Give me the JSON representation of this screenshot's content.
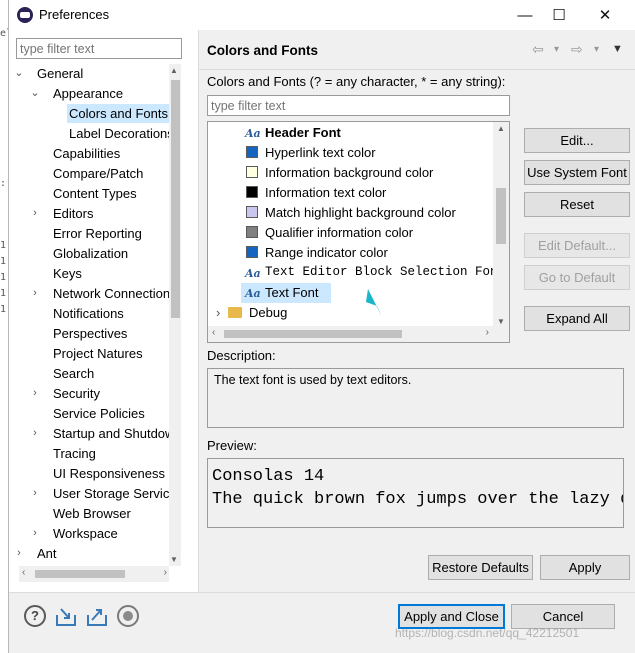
{
  "window": {
    "title": "Preferences"
  },
  "controls": {
    "minimize": "—",
    "maximize": "☐",
    "close": "✕"
  },
  "left": {
    "filter_placeholder": "type filter text",
    "tree": [
      {
        "label": "General",
        "arrow": "⌄",
        "level": 0
      },
      {
        "label": "Appearance",
        "arrow": "⌄",
        "level": 1
      },
      {
        "label": "Colors and Fonts",
        "arrow": "",
        "level": 2,
        "selected": true
      },
      {
        "label": "Label Decorations",
        "arrow": "",
        "level": 2
      },
      {
        "label": "Capabilities",
        "arrow": "",
        "level": 1
      },
      {
        "label": "Compare/Patch",
        "arrow": "",
        "level": 1
      },
      {
        "label": "Content Types",
        "arrow": "",
        "level": 1
      },
      {
        "label": "Editors",
        "arrow": "›",
        "level": 1
      },
      {
        "label": "Error Reporting",
        "arrow": "",
        "level": 1
      },
      {
        "label": "Globalization",
        "arrow": "",
        "level": 1
      },
      {
        "label": "Keys",
        "arrow": "",
        "level": 1
      },
      {
        "label": "Network Connections",
        "arrow": "›",
        "level": 1
      },
      {
        "label": "Notifications",
        "arrow": "",
        "level": 1
      },
      {
        "label": "Perspectives",
        "arrow": "",
        "level": 1
      },
      {
        "label": "Project Natures",
        "arrow": "",
        "level": 1
      },
      {
        "label": "Search",
        "arrow": "",
        "level": 1
      },
      {
        "label": "Security",
        "arrow": "›",
        "level": 1
      },
      {
        "label": "Service Policies",
        "arrow": "",
        "level": 1
      },
      {
        "label": "Startup and Shutdown",
        "arrow": "›",
        "level": 1
      },
      {
        "label": "Tracing",
        "arrow": "",
        "level": 1
      },
      {
        "label": "UI Responsiveness",
        "arrow": "",
        "level": 1
      },
      {
        "label": "User Storage Service",
        "arrow": "›",
        "level": 1
      },
      {
        "label": "Web Browser",
        "arrow": "",
        "level": 1
      },
      {
        "label": "Workspace",
        "arrow": "›",
        "level": 1
      },
      {
        "label": "Ant",
        "arrow": "›",
        "level": 0
      }
    ]
  },
  "page": {
    "title": "Colors and Fonts",
    "nav": {
      "back": "⇦",
      "back_menu": "▾",
      "forward": "⇨",
      "forward_menu": "▾",
      "view_menu": "▼"
    },
    "filter_label": "Colors and Fonts (? = any character, * = any string):",
    "filter_placeholder": "type filter text",
    "items": [
      {
        "label": "Header Font",
        "kind": "font",
        "bold": true
      },
      {
        "label": "Hyperlink text color",
        "kind": "color",
        "color": "#1565c0"
      },
      {
        "label": "Information background color",
        "kind": "color",
        "color": "#ffffe1"
      },
      {
        "label": "Information text color",
        "kind": "color",
        "color": "#000000"
      },
      {
        "label": "Match highlight background color",
        "kind": "color",
        "color": "#c9c6ef"
      },
      {
        "label": "Qualifier information color",
        "kind": "color",
        "color": "#808080"
      },
      {
        "label": "Range indicator color",
        "kind": "color",
        "color": "#1565c0"
      },
      {
        "label": "Text Editor Block Selection Font",
        "kind": "font",
        "mono": true
      },
      {
        "label": "Text Font",
        "kind": "font",
        "selected": true
      },
      {
        "label": "Debug",
        "kind": "folder"
      }
    ],
    "font_icon_text": "Aa",
    "buttons": {
      "edit": "Edit...",
      "use_system_font": "Use System Font",
      "reset": "Reset",
      "edit_default": "Edit Default...",
      "go_to_default": "Go to Default",
      "expand_all": "Expand All"
    },
    "description_label": "Description:",
    "description_text": "The text font is used by text editors.",
    "preview_label": "Preview:",
    "preview_lines": [
      "Consolas 14",
      "The quick brown fox jumps over the lazy dog."
    ],
    "restore_defaults": "Restore Defaults",
    "apply": "Apply"
  },
  "footer": {
    "help": "?",
    "apply_and_close": "Apply and Close",
    "cancel": "Cancel",
    "watermark": "https://blog.csdn.net/qq_42212501"
  },
  "colors": {
    "selection": "#cce8ff",
    "accent": "#0078d7",
    "cursor": "#19b5c8"
  }
}
